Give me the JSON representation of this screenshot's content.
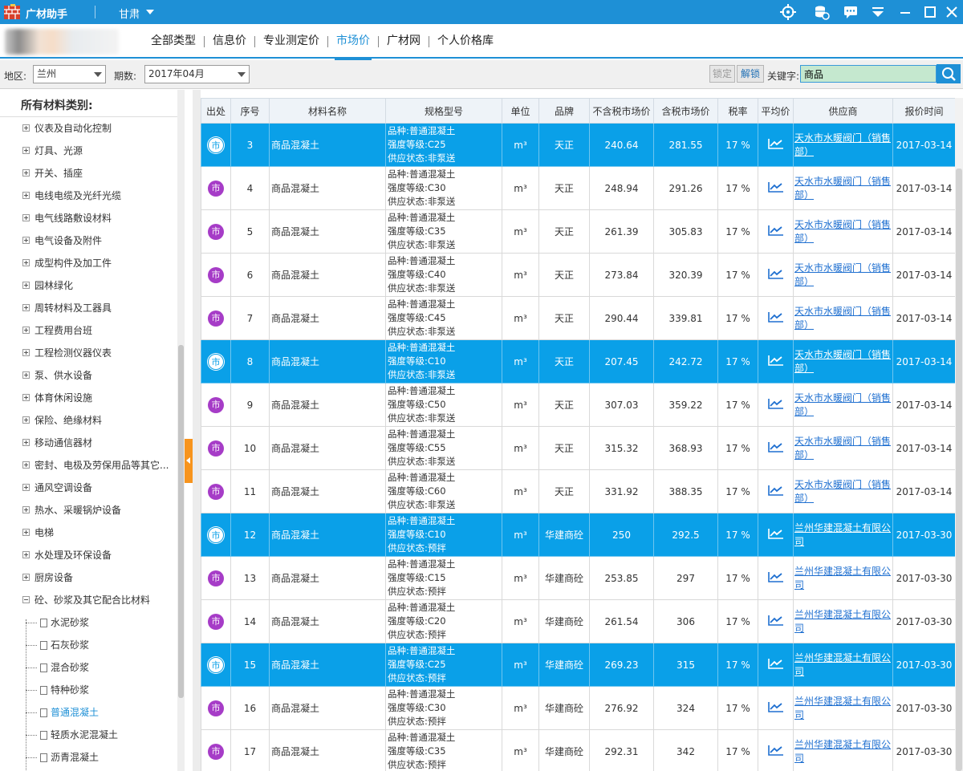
{
  "app": {
    "name": "广材助手",
    "region": "甘肃"
  },
  "nav": {
    "tabs": [
      {
        "label": "全部类型",
        "active": false
      },
      {
        "label": "信息价",
        "active": false
      },
      {
        "label": "专业测定价",
        "active": false
      },
      {
        "label": "市场价",
        "active": true
      },
      {
        "label": "广材网",
        "active": false
      },
      {
        "label": "个人价格库",
        "active": false
      }
    ]
  },
  "filter": {
    "area_label": "地区:",
    "area_value": "兰州",
    "period_label": "期数:",
    "period_value": "2017年04月",
    "lock_label": "锁定",
    "unlock_label": "解锁",
    "keyword_label": "关键字:",
    "keyword_value": "商品"
  },
  "sidebar": {
    "title": "所有材料类别:",
    "categories": [
      "仪表及自动化控制",
      "灯具、光源",
      "开关、插座",
      "电线电缆及光纤光缆",
      "电气线路敷设材料",
      "电气设备及附件",
      "成型构件及加工件",
      "园林绿化",
      "周转材料及工器具",
      "工程费用台班",
      "工程检测仪器仪表",
      "泵、供水设备",
      "体育休闲设施",
      "保险、绝缘材料",
      "移动通信器材",
      "密封、电极及劳保用品等其它...",
      "通风空调设备",
      "热水、采暖锅炉设备",
      "电梯",
      "水处理及环保设备",
      "厨房设备",
      "砼、砂浆及其它配合比材料"
    ],
    "subitems": [
      {
        "label": "水泥砂浆",
        "active": false
      },
      {
        "label": "石灰砂浆",
        "active": false
      },
      {
        "label": "混合砂浆",
        "active": false
      },
      {
        "label": "特种砂浆",
        "active": false
      },
      {
        "label": "普通混凝土",
        "active": true
      },
      {
        "label": "轻质水泥混凝土",
        "active": false
      },
      {
        "label": "沥青混凝土",
        "active": false
      }
    ]
  },
  "table": {
    "headers": [
      "出处",
      "序号",
      "材料名称",
      "规格型号",
      "单位",
      "品牌",
      "不含税市场价",
      "含税市场价",
      "税率",
      "平均价",
      "供应商",
      "报价时间"
    ],
    "rows": [
      {
        "src": "市",
        "no": "3",
        "name": "商品混凝土",
        "spec": [
          "品种:普通混凝土",
          "强度等级:C25",
          "供应状态:非泵送"
        ],
        "unit": "m³",
        "brand": "天正",
        "price_ex": "240.64",
        "price_in": "281.55",
        "tax": "17 %",
        "supplier": "天水市水暖阀门（销售部）",
        "date": "2017-03-14",
        "hl": true
      },
      {
        "src": "市",
        "no": "4",
        "name": "商品混凝土",
        "spec": [
          "品种:普通混凝土",
          "强度等级:C30",
          "供应状态:非泵送"
        ],
        "unit": "m³",
        "brand": "天正",
        "price_ex": "248.94",
        "price_in": "291.26",
        "tax": "17 %",
        "supplier": "天水市水暖阀门（销售部）",
        "date": "2017-03-14",
        "hl": false
      },
      {
        "src": "市",
        "no": "5",
        "name": "商品混凝土",
        "spec": [
          "品种:普通混凝土",
          "强度等级:C35",
          "供应状态:非泵送"
        ],
        "unit": "m³",
        "brand": "天正",
        "price_ex": "261.39",
        "price_in": "305.83",
        "tax": "17 %",
        "supplier": "天水市水暖阀门（销售部）",
        "date": "2017-03-14",
        "hl": false
      },
      {
        "src": "市",
        "no": "6",
        "name": "商品混凝土",
        "spec": [
          "品种:普通混凝土",
          "强度等级:C40",
          "供应状态:非泵送"
        ],
        "unit": "m³",
        "brand": "天正",
        "price_ex": "273.84",
        "price_in": "320.39",
        "tax": "17 %",
        "supplier": "天水市水暖阀门（销售部）",
        "date": "2017-03-14",
        "hl": false
      },
      {
        "src": "市",
        "no": "7",
        "name": "商品混凝土",
        "spec": [
          "品种:普通混凝土",
          "强度等级:C45",
          "供应状态:非泵送"
        ],
        "unit": "m³",
        "brand": "天正",
        "price_ex": "290.44",
        "price_in": "339.81",
        "tax": "17 %",
        "supplier": "天水市水暖阀门（销售部）",
        "date": "2017-03-14",
        "hl": false
      },
      {
        "src": "市",
        "no": "8",
        "name": "商品混凝土",
        "spec": [
          "品种:普通混凝土",
          "强度等级:C10",
          "供应状态:非泵送"
        ],
        "unit": "m³",
        "brand": "天正",
        "price_ex": "207.45",
        "price_in": "242.72",
        "tax": "17 %",
        "supplier": "天水市水暖阀门（销售部）",
        "date": "2017-03-14",
        "hl": true
      },
      {
        "src": "市",
        "no": "9",
        "name": "商品混凝土",
        "spec": [
          "品种:普通混凝土",
          "强度等级:C50",
          "供应状态:非泵送"
        ],
        "unit": "m³",
        "brand": "天正",
        "price_ex": "307.03",
        "price_in": "359.22",
        "tax": "17 %",
        "supplier": "天水市水暖阀门（销售部）",
        "date": "2017-03-14",
        "hl": false
      },
      {
        "src": "市",
        "no": "10",
        "name": "商品混凝土",
        "spec": [
          "品种:普通混凝土",
          "强度等级:C55",
          "供应状态:非泵送"
        ],
        "unit": "m³",
        "brand": "天正",
        "price_ex": "315.32",
        "price_in": "368.93",
        "tax": "17 %",
        "supplier": "天水市水暖阀门（销售部）",
        "date": "2017-03-14",
        "hl": false
      },
      {
        "src": "市",
        "no": "11",
        "name": "商品混凝土",
        "spec": [
          "品种:普通混凝土",
          "强度等级:C60",
          "供应状态:非泵送"
        ],
        "unit": "m³",
        "brand": "天正",
        "price_ex": "331.92",
        "price_in": "388.35",
        "tax": "17 %",
        "supplier": "天水市水暖阀门（销售部）",
        "date": "2017-03-14",
        "hl": false
      },
      {
        "src": "市",
        "no": "12",
        "name": "商品混凝土",
        "spec": [
          "品种:普通混凝土",
          "强度等级:C10",
          "供应状态:预拌"
        ],
        "unit": "m³",
        "brand": "华建商砼",
        "price_ex": "250",
        "price_in": "292.5",
        "tax": "17 %",
        "supplier": "兰州华建混凝土有限公司",
        "date": "2017-03-30",
        "hl": true
      },
      {
        "src": "市",
        "no": "13",
        "name": "商品混凝土",
        "spec": [
          "品种:普通混凝土",
          "强度等级:C15",
          "供应状态:预拌"
        ],
        "unit": "m³",
        "brand": "华建商砼",
        "price_ex": "253.85",
        "price_in": "297",
        "tax": "17 %",
        "supplier": "兰州华建混凝土有限公司",
        "date": "2017-03-30",
        "hl": false
      },
      {
        "src": "市",
        "no": "14",
        "name": "商品混凝土",
        "spec": [
          "品种:普通混凝土",
          "强度等级:C20",
          "供应状态:预拌"
        ],
        "unit": "m³",
        "brand": "华建商砼",
        "price_ex": "261.54",
        "price_in": "306",
        "tax": "17 %",
        "supplier": "兰州华建混凝土有限公司",
        "date": "2017-03-30",
        "hl": false
      },
      {
        "src": "市",
        "no": "15",
        "name": "商品混凝土",
        "spec": [
          "品种:普通混凝土",
          "强度等级:C25",
          "供应状态:预拌"
        ],
        "unit": "m³",
        "brand": "华建商砼",
        "price_ex": "269.23",
        "price_in": "315",
        "tax": "17 %",
        "supplier": "兰州华建混凝土有限公司",
        "date": "2017-03-30",
        "hl": true
      },
      {
        "src": "市",
        "no": "16",
        "name": "商品混凝土",
        "spec": [
          "品种:普通混凝土",
          "强度等级:C30",
          "供应状态:预拌"
        ],
        "unit": "m³",
        "brand": "华建商砼",
        "price_ex": "276.92",
        "price_in": "324",
        "tax": "17 %",
        "supplier": "兰州华建混凝土有限公司",
        "date": "2017-03-30",
        "hl": false
      },
      {
        "src": "市",
        "no": "17",
        "name": "商品混凝土",
        "spec": [
          "品种:普通混凝土",
          "强度等级:C35",
          "供应状态:预拌"
        ],
        "unit": "m³",
        "brand": "华建商砼",
        "price_ex": "292.31",
        "price_in": "342",
        "tax": "17 %",
        "supplier": "兰州华建混凝土有限公司",
        "date": "2017-03-30",
        "hl": false
      }
    ]
  },
  "icons": {
    "logo": "brick-wall-icon",
    "trend": "line-chart-icon",
    "search": "search-icon"
  },
  "colors": {
    "brand": "#1e90d6",
    "row_highlight": "#0aa0e8",
    "source_badge": "#a63cc7",
    "link": "#1e6fd0",
    "keyword_bg": "#c5e8cf",
    "collapse_tab": "#f7941d"
  }
}
